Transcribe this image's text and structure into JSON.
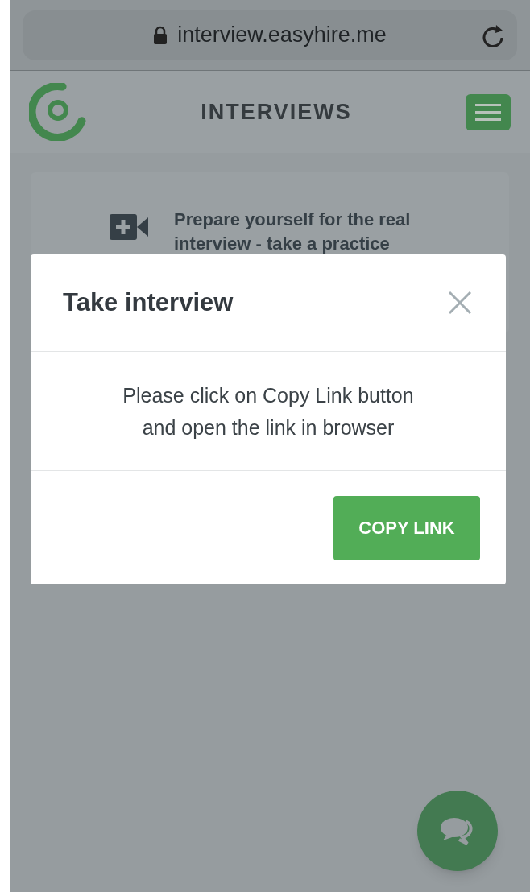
{
  "browser": {
    "url": "interview.easyhire.me"
  },
  "header": {
    "title": "INTERVIEWS"
  },
  "card": {
    "text_lines": [
      "Prepare yourself for the real",
      "interview - take a practice"
    ]
  },
  "modal": {
    "title": "Take interview",
    "message_lines": [
      "Please click on Copy Link button",
      "and open the link in browser"
    ],
    "button": "COPY LINK"
  }
}
